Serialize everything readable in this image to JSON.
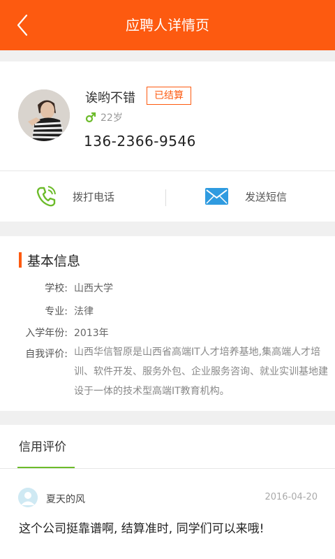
{
  "header": {
    "title": "应聘人详情页",
    "back_icon": "chevron-left-icon",
    "bg_color": "#fd5a10"
  },
  "profile": {
    "name": "诶哟不错",
    "status_badge": "已结算",
    "gender_icon": "male-icon",
    "age": "22岁",
    "phone": "136-2366-9546"
  },
  "actions": {
    "call_label": "拨打电话",
    "call_icon": "phone-icon",
    "sms_label": "发送短信",
    "sms_icon": "envelope-icon"
  },
  "basic_info": {
    "title": "基本信息",
    "school_label": "学校:",
    "school": "山西大学",
    "major_label": "专业:",
    "major": "法律",
    "year_label": "入学年份:",
    "year": "2013年",
    "intro_label": "自我评价:",
    "intro": "山西华信智原是山西省高端IT人才培养基地,集高端人才培训、软件开发、服务外包、企业服务咨询、就业实训基地建设于一体的技术型高端IT教育机构。"
  },
  "credit": {
    "tab_label": "信用评价",
    "comments": [
      {
        "user": "夏天的风",
        "date": "2016-04-20",
        "text": "这个公司挺靠谱啊, 结算准时, 同学们可以来哦!"
      }
    ]
  },
  "colors": {
    "accent": "#fd5a10",
    "green": "#6cbb2a",
    "blue": "#2f9be0"
  }
}
